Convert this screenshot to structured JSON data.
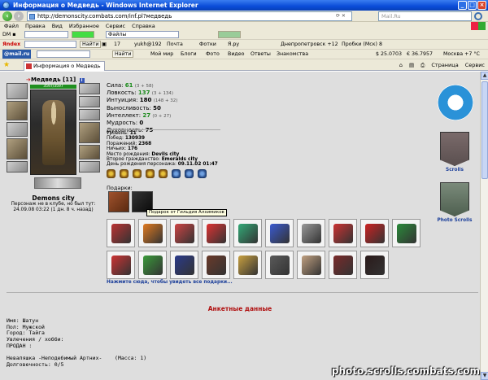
{
  "window": {
    "title": "Информация о Медведь - Windows Internet Explorer",
    "url": "http://demonscity.combats.com/inf.pl?медведь",
    "search_placeholder": "Mail.Ru"
  },
  "menu": [
    "Файл",
    "Правка",
    "Вид",
    "Избранное",
    "Сервис",
    "Справка"
  ],
  "toolbar1": {
    "files_label": "Файлы",
    "count": "17",
    "yukh": "yukh@192",
    "mail": "Почта",
    "photo": "Фотки",
    "ya": "Я.ру",
    "city": "Днепропетровск +12",
    "traffic": "Пробки (Мск) 8"
  },
  "toolbar2": {
    "find_label": "Найти",
    "my_world": "Мой мир",
    "blogs": "Блоги",
    "photo": "Фото",
    "video": "Видео",
    "answers": "Ответы",
    "dating": "Знакомства",
    "usd": "$ 25.0703",
    "eur": "€ 36.7957",
    "weather": "Москва +7 °C"
  },
  "toolbar3": {
    "logo": "@mail.ru",
    "find_label": "Найти"
  },
  "tab": {
    "label": "Информация о Медведь",
    "page_label": "Страница",
    "service_label": "Сервис"
  },
  "character": {
    "name": "Медведь",
    "level": "[11]",
    "hp": "3597/3597",
    "city": "Demons city",
    "offline_line1": "Персонаж не в клубе, но был тут:",
    "offline_line2": "24.09.08 03:22 (1 дн. 8 ч. назад)"
  },
  "stats": [
    {
      "label": "Сила:",
      "value": "61",
      "sub": "(3 + 58)",
      "green": true
    },
    {
      "label": "Ловкость:",
      "value": "137",
      "sub": "(3 + 134)",
      "green": true
    },
    {
      "label": "Интуиция:",
      "value": "180",
      "sub": "(148 + 32)",
      "green": false
    },
    {
      "label": "Выносливость:",
      "value": "50",
      "sub": "",
      "green": false
    },
    {
      "label": "Интеллект:",
      "value": "27",
      "sub": "(0 + 27)",
      "green": true
    },
    {
      "label": "Мудрость:",
      "value": "0",
      "sub": "",
      "green": false
    },
    {
      "label": "Духовность:",
      "value": "75",
      "sub": "",
      "green": false
    }
  ],
  "info": [
    {
      "label": "Уровень:",
      "value": "11"
    },
    {
      "label": "Побед:",
      "value": "130939"
    },
    {
      "label": "Поражений:",
      "value": "2368"
    },
    {
      "label": "Ничьих:",
      "value": "176"
    },
    {
      "label": "Место рождения:",
      "value": "Devils city"
    },
    {
      "label": "Второе гражданство:",
      "value": "Emeralds city"
    },
    {
      "label": "День рождения персонажа:",
      "value": "09.11.02 01:47"
    }
  ],
  "gifts": {
    "label": "Подарки:",
    "tooltip": "Подарок от Гильдия Алхимиков",
    "more_link": "Нажмите сюда, чтобы увидеть все подарки..."
  },
  "right_panel": {
    "scrolls": "Scrolls",
    "photo_scrolls": "Photo Scrolls"
  },
  "profile": {
    "title": "Анкетные данные",
    "lines": [
      "Имя: Шатун",
      "Пол: Мужской",
      "Город: Тайга",
      "Увлечения / хобби:",
      "ПРОДАН :",
      "",
      "Неваляшка -Неподебимый Артних-    (Масса: 1)",
      "Долговечность: 0/5"
    ]
  },
  "watermark": "photo.scrolls.combats.com",
  "colors": {
    "title_bar": "#0a4cd8",
    "chrome": "#ece9d8",
    "page_bg": "#dedede",
    "accent_red": "#b01010",
    "link_blue": "#1c3f9a",
    "stat_green": "#1a8a1a"
  }
}
